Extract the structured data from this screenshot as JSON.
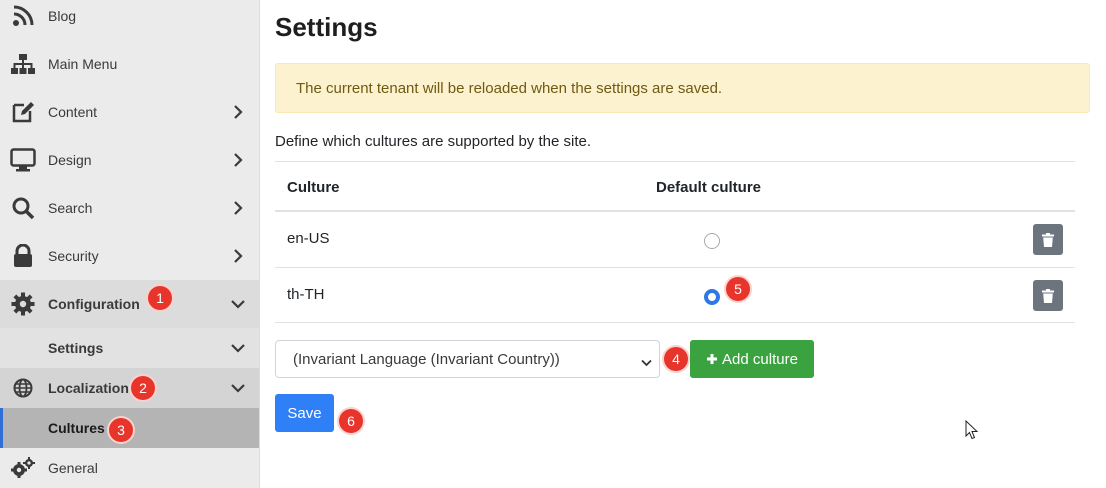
{
  "sidebar": {
    "items": [
      {
        "label": "Blog",
        "icon": "rss-icon"
      },
      {
        "label": "Main Menu",
        "icon": "sitemap-icon"
      },
      {
        "label": "Content",
        "icon": "edit-icon"
      },
      {
        "label": "Design",
        "icon": "monitor-icon"
      },
      {
        "label": "Search",
        "icon": "search-icon"
      },
      {
        "label": "Security",
        "icon": "lock-icon"
      },
      {
        "label": "Configuration",
        "icon": "gear-icon"
      },
      {
        "label": "Settings"
      },
      {
        "label": "Localization",
        "icon": "globe-icon"
      },
      {
        "label": "Cultures"
      },
      {
        "label": "General",
        "icon": "gears-icon"
      }
    ]
  },
  "main": {
    "title": "Settings",
    "alert": "The current tenant will be reloaded when the settings are saved.",
    "description": "Define which cultures are supported by the site.",
    "table": {
      "headers": [
        "Culture",
        "Default culture"
      ],
      "rows": [
        {
          "culture": "en-US",
          "is_default": false
        },
        {
          "culture": "th-TH",
          "is_default": true
        }
      ]
    },
    "culture_select": {
      "selected": "(Invariant Language (Invariant Country))"
    },
    "add_button": {
      "icon": "plus-icon",
      "label": "Add culture"
    },
    "save_button": {
      "label": "Save"
    }
  },
  "badges": [
    "1",
    "2",
    "3",
    "4",
    "5",
    "6"
  ],
  "colors": {
    "badge": "#e8352c",
    "add_button": "#3aa33f",
    "save_button": "#2f7ff6",
    "alert_bg": "#fdf2cf",
    "active_accent": "#2f6fd6"
  }
}
